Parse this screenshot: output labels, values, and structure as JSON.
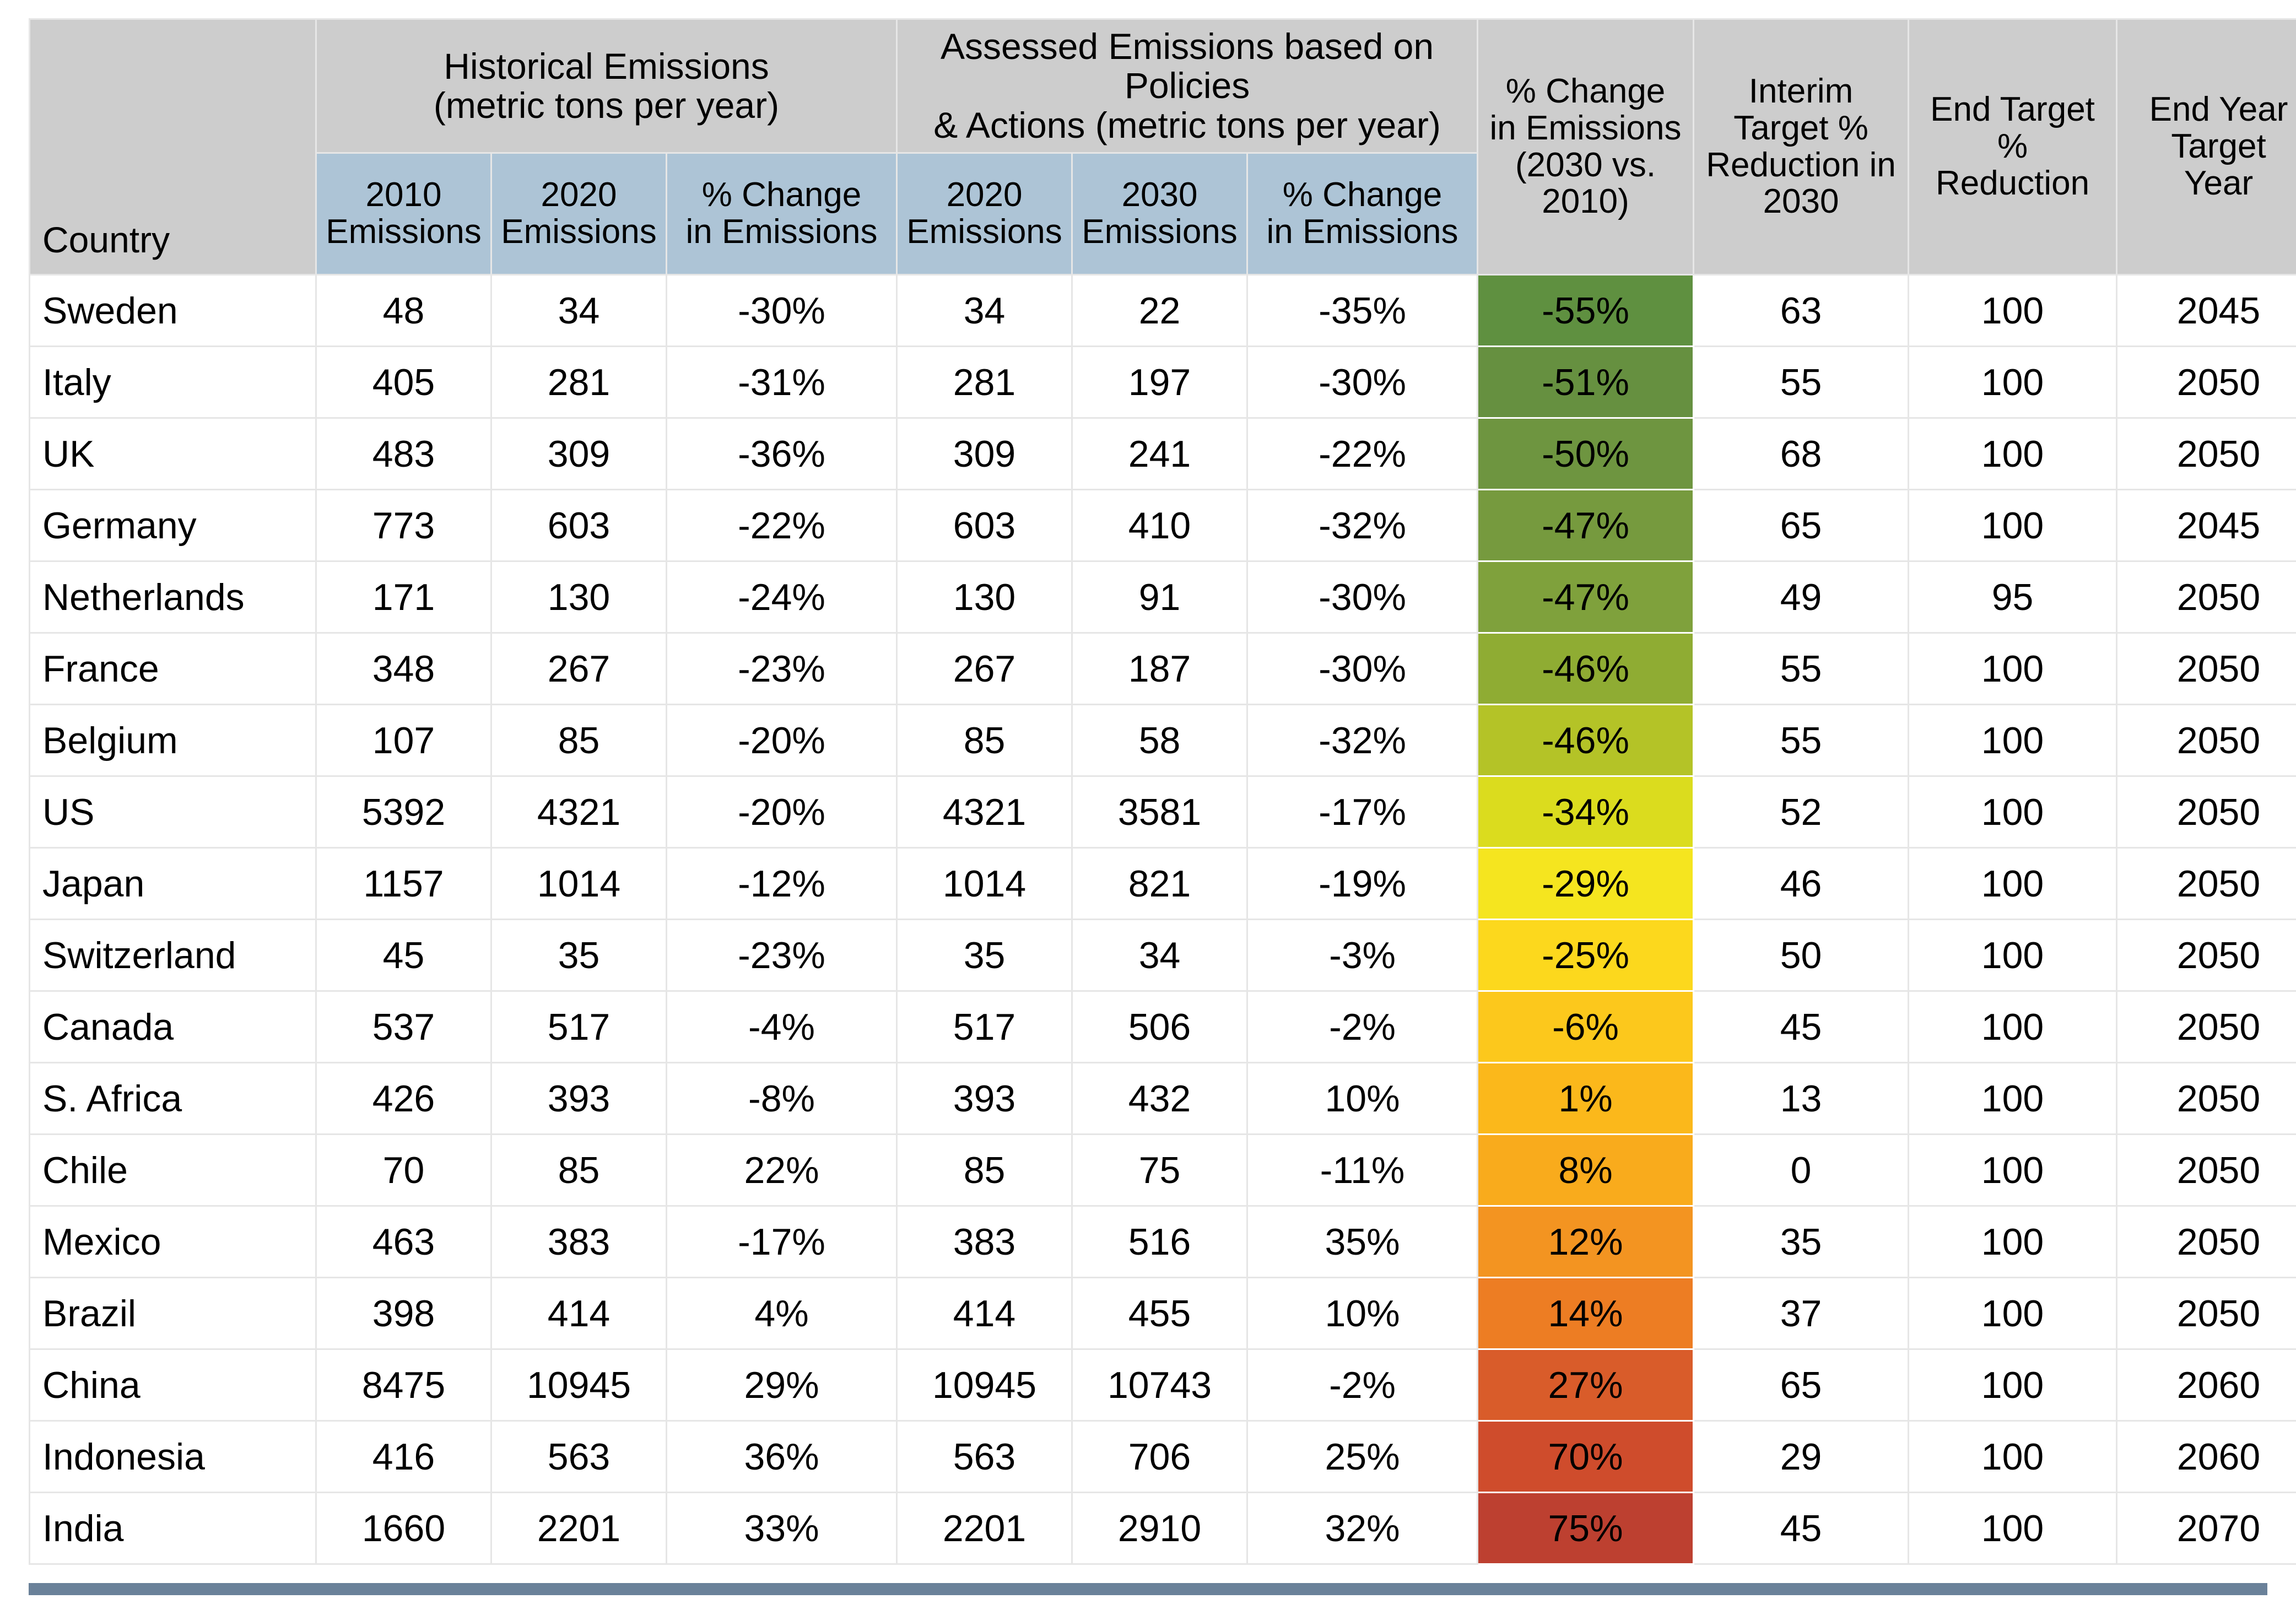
{
  "table": {
    "group_headers": {
      "country": "Country",
      "historical": "Historical Emissions\n(metric tons per year)",
      "historical_line1": "Historical Emissions",
      "historical_line2": "(metric tons per year)",
      "assessed_line1": "Assessed Emissions based on Policies",
      "assessed_line2": "& Actions (metric tons per year)",
      "pct_change_2030_l1": "% Change",
      "pct_change_2030_l2": "in Emissions",
      "pct_change_2030_l3": "(2030 vs.",
      "pct_change_2030_l4": "2010)",
      "interim_l1": "Interim",
      "interim_l2": "Target %",
      "interim_l3": "Reduction in",
      "interim_l4": "2030",
      "end_target_l1": "End Target",
      "end_target_l2": "%",
      "end_target_l3": "Reduction",
      "end_year_l1": "End Year",
      "end_year_l2": "Target",
      "end_year_l3": "Year"
    },
    "sub_headers": {
      "hist_2010_l1": "2010",
      "hist_2010_l2": "Emissions",
      "hist_2020_l1": "2020",
      "hist_2020_l2": "Emissions",
      "hist_pct_l1": "% Change",
      "hist_pct_l2": "in Emissions",
      "assessed_2020_l1": "2020",
      "assessed_2020_l2": "Emissions",
      "assessed_2030_l1": "2030",
      "assessed_2030_l2": "Emissions",
      "assessed_pct_l1": "% Change",
      "assessed_pct_l2": "in Emissions"
    },
    "columns": [
      "Country",
      "2010 Emissions",
      "2020 Emissions",
      "% Change in Emissions",
      "2020 Emissions",
      "2030 Emissions",
      "% Change in Emissions",
      "% Change in Emissions (2030 vs. 2010)",
      "Interim Target % Reduction in 2030",
      "End Target % Reduction",
      "End Year Target Year"
    ],
    "rows": [
      {
        "country": "Sweden",
        "h2010": "48",
        "h2020": "34",
        "hpct": "-30%",
        "a2020": "34",
        "a2030": "22",
        "apct": "-35%",
        "change": "-55%",
        "interim": "63",
        "end_target": "100",
        "end_year": "2045",
        "heat": "#5f9040"
      },
      {
        "country": "Italy",
        "h2010": "405",
        "h2020": "281",
        "hpct": "-31%",
        "a2020": "281",
        "a2030": "197",
        "apct": "-30%",
        "change": "-51%",
        "interim": "55",
        "end_target": "100",
        "end_year": "2050",
        "heat": "#669040"
      },
      {
        "country": "UK",
        "h2010": "483",
        "h2020": "309",
        "hpct": "-36%",
        "a2020": "309",
        "a2030": "241",
        "apct": "-22%",
        "change": "-50%",
        "interim": "68",
        "end_target": "100",
        "end_year": "2050",
        "heat": "#6e9540"
      },
      {
        "country": "Germany",
        "h2010": "773",
        "h2020": "603",
        "hpct": "-22%",
        "a2020": "603",
        "a2030": "410",
        "apct": "-32%",
        "change": "-47%",
        "interim": "65",
        "end_target": "100",
        "end_year": "2045",
        "heat": "#769a3e"
      },
      {
        "country": "Netherlands",
        "h2010": "171",
        "h2020": "130",
        "hpct": "-24%",
        "a2020": "130",
        "a2030": "91",
        "apct": "-30%",
        "change": "-47%",
        "interim": "49",
        "end_target": "95",
        "end_year": "2050",
        "heat": "#7fa13c"
      },
      {
        "country": "France",
        "h2010": "348",
        "h2020": "267",
        "hpct": "-23%",
        "a2020": "267",
        "a2030": "187",
        "apct": "-30%",
        "change": "-46%",
        "interim": "55",
        "end_target": "100",
        "end_year": "2050",
        "heat": "#8fac33"
      },
      {
        "country": "Belgium",
        "h2010": "107",
        "h2020": "85",
        "hpct": "-20%",
        "a2020": "85",
        "a2030": "58",
        "apct": "-32%",
        "change": "-46%",
        "interim": "55",
        "end_target": "100",
        "end_year": "2050",
        "heat": "#b4c327"
      },
      {
        "country": "US",
        "h2010": "5392",
        "h2020": "4321",
        "hpct": "-20%",
        "a2020": "4321",
        "a2030": "3581",
        "apct": "-17%",
        "change": "-34%",
        "interim": "52",
        "end_target": "100",
        "end_year": "2050",
        "heat": "#dbdc1e"
      },
      {
        "country": "Japan",
        "h2010": "1157",
        "h2020": "1014",
        "hpct": "-12%",
        "a2020": "1014",
        "a2030": "821",
        "apct": "-19%",
        "change": "-29%",
        "interim": "46",
        "end_target": "100",
        "end_year": "2050",
        "heat": "#f5e51f"
      },
      {
        "country": "Switzerland",
        "h2010": "45",
        "h2020": "35",
        "hpct": "-23%",
        "a2020": "35",
        "a2030": "34",
        "apct": "-3%",
        "change": "-25%",
        "interim": "50",
        "end_target": "100",
        "end_year": "2050",
        "heat": "#fcd81d"
      },
      {
        "country": "Canada",
        "h2010": "537",
        "h2020": "517",
        "hpct": "-4%",
        "a2020": "517",
        "a2030": "506",
        "apct": "-2%",
        "change": "-6%",
        "interim": "45",
        "end_target": "100",
        "end_year": "2050",
        "heat": "#fcc81c"
      },
      {
        "country": "S. Africa",
        "h2010": "426",
        "h2020": "393",
        "hpct": "-8%",
        "a2020": "393",
        "a2030": "432",
        "apct": "10%",
        "change": "1%",
        "interim": "13",
        "end_target": "100",
        "end_year": "2050",
        "heat": "#fbb81b"
      },
      {
        "country": "Chile",
        "h2010": "70",
        "h2020": "85",
        "hpct": "22%",
        "a2020": "85",
        "a2030": "75",
        "apct": "-11%",
        "change": "8%",
        "interim": "0",
        "end_target": "100",
        "end_year": "2050",
        "heat": "#f9ab1c"
      },
      {
        "country": "Mexico",
        "h2010": "463",
        "h2020": "383",
        "hpct": "-17%",
        "a2020": "383",
        "a2030": "516",
        "apct": "35%",
        "change": "12%",
        "interim": "35",
        "end_target": "100",
        "end_year": "2050",
        "heat": "#f39421"
      },
      {
        "country": "Brazil",
        "h2010": "398",
        "h2020": "414",
        "hpct": "4%",
        "a2020": "414",
        "a2030": "455",
        "apct": "10%",
        "change": "14%",
        "interim": "37",
        "end_target": "100",
        "end_year": "2050",
        "heat": "#ed7d23"
      },
      {
        "country": "China",
        "h2010": "8475",
        "h2020": "10945",
        "hpct": "29%",
        "a2020": "10945",
        "a2030": "10743",
        "apct": "-2%",
        "change": "27%",
        "interim": "65",
        "end_target": "100",
        "end_year": "2060",
        "heat": "#d95c2a"
      },
      {
        "country": "Indonesia",
        "h2010": "416",
        "h2020": "563",
        "hpct": "36%",
        "a2020": "563",
        "a2030": "706",
        "apct": "25%",
        "change": "70%",
        "interim": "29",
        "end_target": "100",
        "end_year": "2060",
        "heat": "#cf4c2c"
      },
      {
        "country": "India",
        "h2010": "1660",
        "h2020": "2201",
        "hpct": "33%",
        "a2020": "2201",
        "a2030": "2910",
        "apct": "32%",
        "change": "75%",
        "interim": "45",
        "end_target": "100",
        "end_year": "2070",
        "heat": "#bd4030"
      }
    ],
    "colors": {
      "group_header_bg": "#cdcdcd",
      "sub_header_bg": "#adc4d6",
      "grid_line": "#e6e6e6",
      "bottom_rule": "#6a8199",
      "heat_min": "#5f9040",
      "heat_mid": "#f5e51f",
      "heat_max": "#bd4030"
    }
  }
}
